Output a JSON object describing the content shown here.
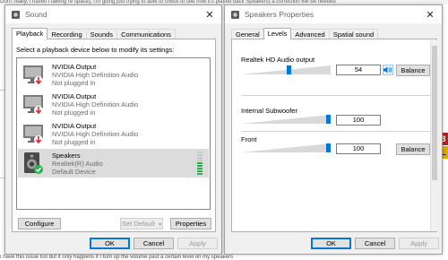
{
  "background": {
    "top_text": "Don't really, I haven't talking re space), I'm going just trying to able to check to see how it's played back Speakers) a correction will be needed",
    "bottom_text": "I have this issue too but it only happens if I turn up the volume past a certain level on my speakers",
    "right_strip": [
      "3",
      "L"
    ]
  },
  "sound_window": {
    "title": "Sound",
    "tabs": [
      "Playback",
      "Recording",
      "Sounds",
      "Communications"
    ],
    "instruction": "Select a playback device below to modify its settings:",
    "devices": [
      {
        "name": "NVIDIA Output",
        "driver": "NVIDIA High Definition Audio",
        "status": "Not plugged in"
      },
      {
        "name": "NVIDIA Output",
        "driver": "NVIDIA High Definition Audio",
        "status": "Not plugged in"
      },
      {
        "name": "NVIDIA Output",
        "driver": "NVIDIA High Definition Audio",
        "status": "Not plugged in"
      },
      {
        "name": "Speakers",
        "driver": "Realtek(R) Audio",
        "status": "Default Device"
      }
    ],
    "buttons": {
      "configure": "Configure",
      "set_default": "Set Default",
      "properties": "Properties",
      "ok": "OK",
      "cancel": "Cancel",
      "apply": "Apply"
    }
  },
  "properties_window": {
    "title": "Speakers Properties",
    "tabs": [
      "General",
      "Levels",
      "Advanced",
      "Spatial sound"
    ],
    "levels": [
      {
        "label": "Realtek HD Audio output",
        "value": "54",
        "level": 0.54,
        "has_speaker_button": true,
        "balance": "Balance"
      },
      {
        "label": "Internal Subwoofer",
        "value": "100",
        "level": 1.0,
        "has_speaker_button": false,
        "balance": ""
      },
      {
        "label": "Front",
        "value": "100",
        "level": 1.0,
        "has_speaker_button": false,
        "balance": "Balance"
      }
    ],
    "buttons": {
      "ok": "OK",
      "cancel": "Cancel",
      "apply": "Apply"
    }
  },
  "colors": {
    "accent": "#0078d7",
    "status_ok": "#2bb24c",
    "status_unplugged": "#d32f2f",
    "selected_row": "#dcdcdc"
  },
  "icons": {
    "sound_window": "speaker-title-icon",
    "properties_window": "speaker-title-icon",
    "device_monitor": "monitor-icon",
    "device_speaker": "speaker-device-icon",
    "unplugged_badge": "red-down-arrow-icon",
    "default_badge": "green-check-icon",
    "mute_toggle": "speaker-volume-icon"
  }
}
